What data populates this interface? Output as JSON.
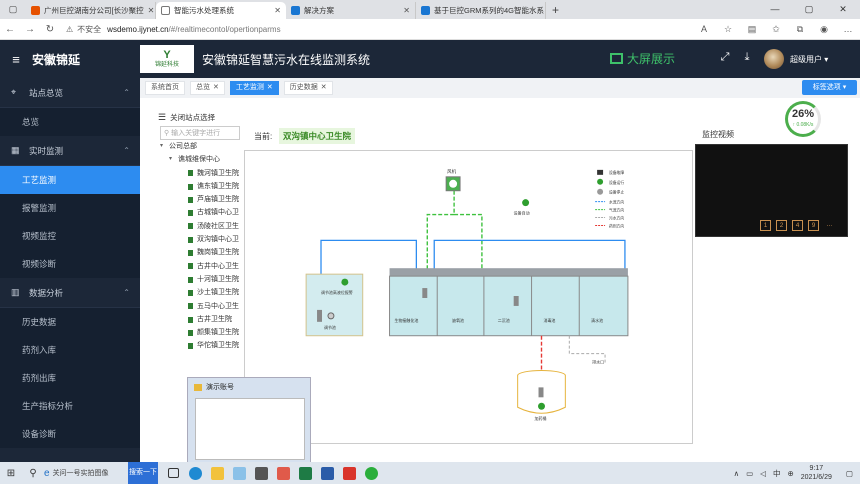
{
  "browser": {
    "tabs": [
      {
        "title": "广州巨控湖南分公司[长沙聚控",
        "color": "#e65100"
      },
      {
        "title": "智能污水处理系统",
        "color": "#666666",
        "active": true
      },
      {
        "title": "解决方案",
        "color": "#1976d2"
      },
      {
        "title": "基于巨控GRM系列的4G智能水系",
        "color": "#1976d2"
      }
    ],
    "address": {
      "warning": "不安全",
      "host": "wsdemo.ijynet.cn",
      "path": "/#/realtimecontol/opertionparms"
    }
  },
  "app": {
    "brand": "安徽锦延",
    "logo_letter": "Y",
    "logo_text": "锦延科技",
    "title": "安徽锦延智慧污水在线监测系统",
    "big_screen": "大屏展示",
    "user": "超级用户"
  },
  "sidebar": {
    "sections": [
      {
        "label": "站点总览",
        "items": [
          "总览"
        ]
      },
      {
        "label": "实时监测",
        "items": [
          "工艺监测",
          "报警监测",
          "视频监控",
          "视频诊断"
        ]
      },
      {
        "label": "数据分析",
        "items": [
          "历史数据",
          "药剂入库",
          "药剂出库",
          "生产指标分析",
          "设备诊断"
        ]
      }
    ],
    "active_item": "工艺监测"
  },
  "page_tabs": [
    "系统首页",
    "总览",
    "工艺监测",
    "历史数据"
  ],
  "active_tab": "工艺监测",
  "tab_options": "标签选项",
  "tree": {
    "close_label": "关闭站点选择",
    "search_placeholder": "输入关键字进行",
    "root": "公司总部",
    "group": "谯城维保中心",
    "stations": [
      "魏河镇卫生院",
      "谯东镇卫生院",
      "芦庙镇卫生院",
      "古城镇中心卫",
      "汤陵社区卫生",
      "双沟镇中心卫",
      "魏岗镇卫生院",
      "古井中心卫生",
      "十河镇卫生院",
      "沙土镇卫生院",
      "五马中心卫生",
      "古井卫生院",
      "颜集镇卫生院",
      "华佗镇卫生院"
    ]
  },
  "current": {
    "label": "当前:",
    "station": "双沟镇中心卫生院"
  },
  "diagram": {
    "fan": "风机",
    "fan_ctrl": "设备自动",
    "pool_box": "调节池高液位报警",
    "pool_label": "调节池",
    "tank_labels": [
      "生物接触化池",
      "缺氧池",
      "二沉池",
      "消毒池",
      "清水池"
    ],
    "outlet": "排水口",
    "dosing": "加药桶",
    "legend": [
      "设备故障",
      "设备运行",
      "设备停止",
      "水流方向",
      "气流方向",
      "污水方向",
      "药剂方向"
    ]
  },
  "monitor": {
    "label": "监控视频",
    "buttons": [
      "1",
      "2",
      "4",
      "9"
    ],
    "more": "..."
  },
  "gauge": {
    "percent": 26,
    "percent_text": "26%",
    "speed": "↑ 0.08K/s"
  },
  "thumbnail": {
    "title": "演示账号"
  },
  "taskbar": {
    "search_text": "关问一号实拍图像",
    "blue_button": "搜索一下",
    "time": "9:17",
    "date": "2021/6/29",
    "lang": "中"
  }
}
